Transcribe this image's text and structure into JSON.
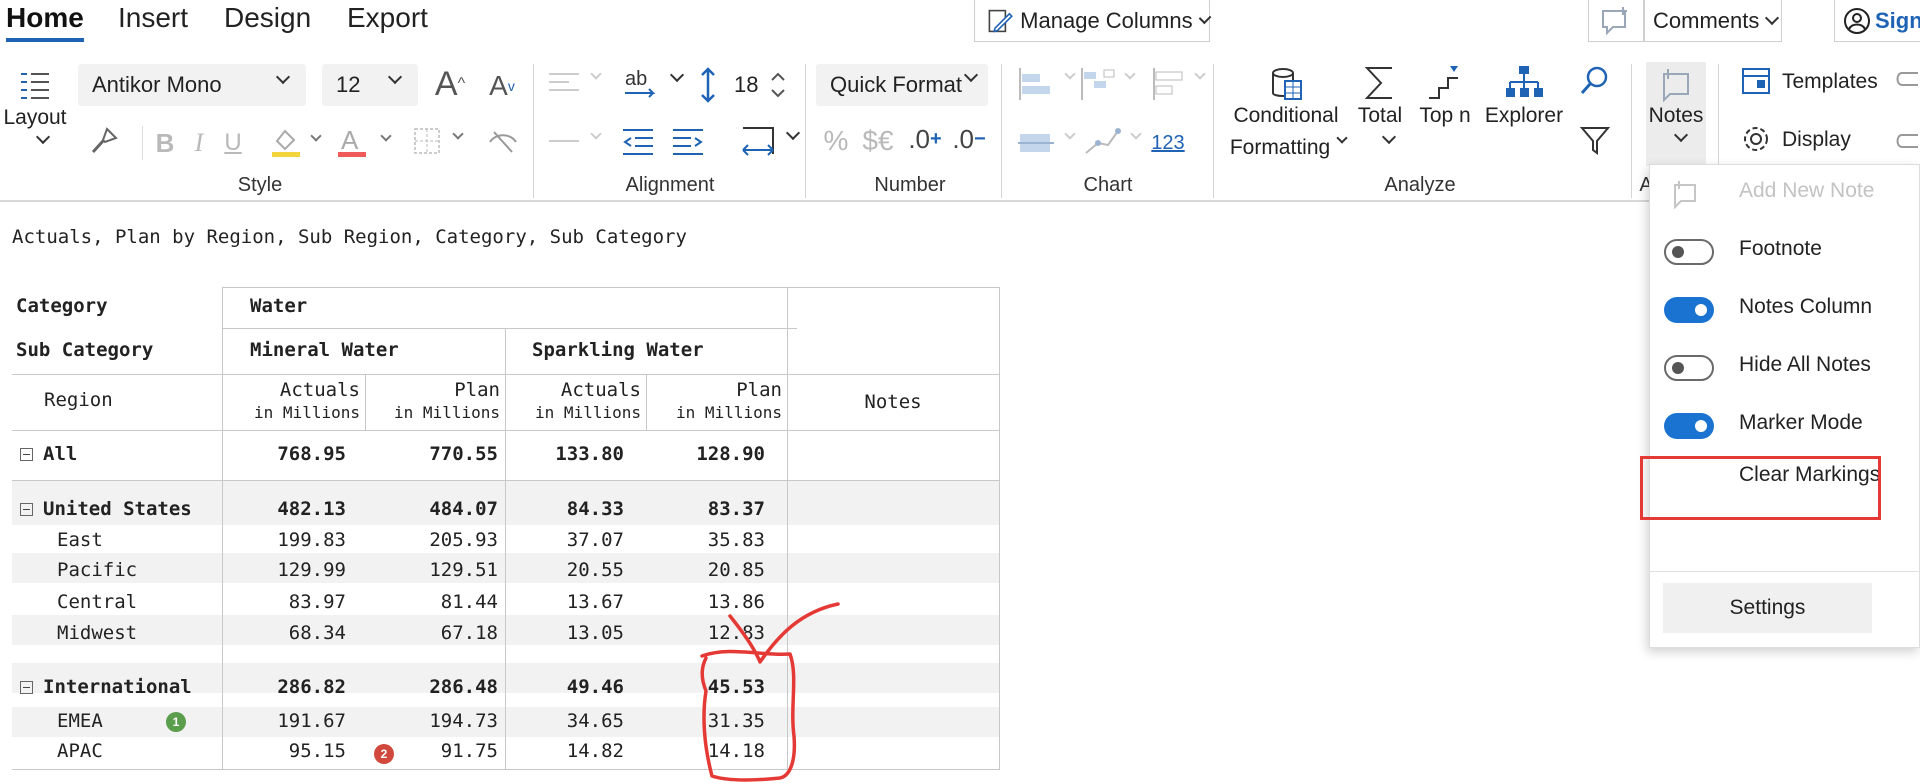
{
  "tabs": [
    {
      "label": "Home",
      "active": true
    },
    {
      "label": "Insert"
    },
    {
      "label": "Design"
    },
    {
      "label": "Export"
    }
  ],
  "top_buttons": {
    "manage_columns": "Manage Columns",
    "comments": "Comments",
    "sign": "Sign"
  },
  "ribbon": {
    "layout": "Layout",
    "font_name": "Antikor Mono",
    "font_size": "12",
    "line_height": "18",
    "quick_format": "Quick Format",
    "conditional": "Conditional",
    "formatting": "Formatting",
    "total": "Total",
    "top_n": "Top n",
    "explorer": "Explorer",
    "notes": "Notes",
    "templates": "Templates",
    "display": "Display",
    "number_123": "123",
    "percent": "%",
    "currency": "$€",
    "decimals_increase": ".0",
    "decimals_decrease": ".0",
    "groups": {
      "style": "Style",
      "alignment": "Alignment",
      "number": "Number",
      "chart": "Chart",
      "analyze": "Analyze",
      "cut": "A"
    }
  },
  "report": {
    "title": "Actuals, Plan by Region, Sub Region, Category, Sub Category",
    "header": {
      "category_label": "Category",
      "category_value": "Water",
      "subcategory_label": "Sub Category",
      "mineral": "Mineral Water",
      "sparkling": "Sparkling Water",
      "region": "Region",
      "notes": "Notes",
      "cols": [
        {
          "name": "Actuals",
          "unit": "in Millions"
        },
        {
          "name": "Plan",
          "unit": "in Millions"
        },
        {
          "name": "Actuals",
          "unit": "in Millions"
        },
        {
          "name": "Plan",
          "unit": "in Millions"
        }
      ]
    },
    "rows": [
      {
        "label": "All",
        "values": [
          "768.95",
          "770.55",
          "133.80",
          "128.90"
        ],
        "bold": true,
        "expand": true
      },
      {
        "label": "United States",
        "values": [
          "482.13",
          "484.07",
          "84.33",
          "83.37"
        ],
        "bold": true,
        "expand": true
      },
      {
        "label": "East",
        "values": [
          "199.83",
          "205.93",
          "37.07",
          "35.83"
        ]
      },
      {
        "label": "Pacific",
        "values": [
          "129.99",
          "129.51",
          "20.55",
          "20.85"
        ]
      },
      {
        "label": "Central",
        "values": [
          "83.97",
          "81.44",
          "13.67",
          "13.86"
        ]
      },
      {
        "label": "Midwest",
        "values": [
          "68.34",
          "67.18",
          "13.05",
          "12.83"
        ]
      },
      {
        "label": "International",
        "values": [
          "286.82",
          "286.48",
          "49.46",
          "45.53"
        ],
        "bold": true,
        "expand": true
      },
      {
        "label": "EMEA",
        "values": [
          "191.67",
          "194.73",
          "34.65",
          "31.35"
        ]
      },
      {
        "label": "APAC",
        "values": [
          "95.15",
          "91.75",
          "14.82",
          "14.18"
        ]
      }
    ],
    "markers": [
      {
        "number": "1",
        "color": "#5a9e4b"
      },
      {
        "number": "2",
        "color": "#d0493c"
      }
    ]
  },
  "notes_menu": {
    "add_new_note": "Add New Note",
    "footnote": "Footnote",
    "notes_column": "Notes Column",
    "hide_all_notes": "Hide All Notes",
    "marker_mode": "Marker Mode",
    "clear_markings": "Clear Markings",
    "settings": "Settings"
  },
  "colors": {
    "accent": "#1f63b5",
    "toggle_on": "#1a73d1",
    "highlight": "#e53935"
  }
}
